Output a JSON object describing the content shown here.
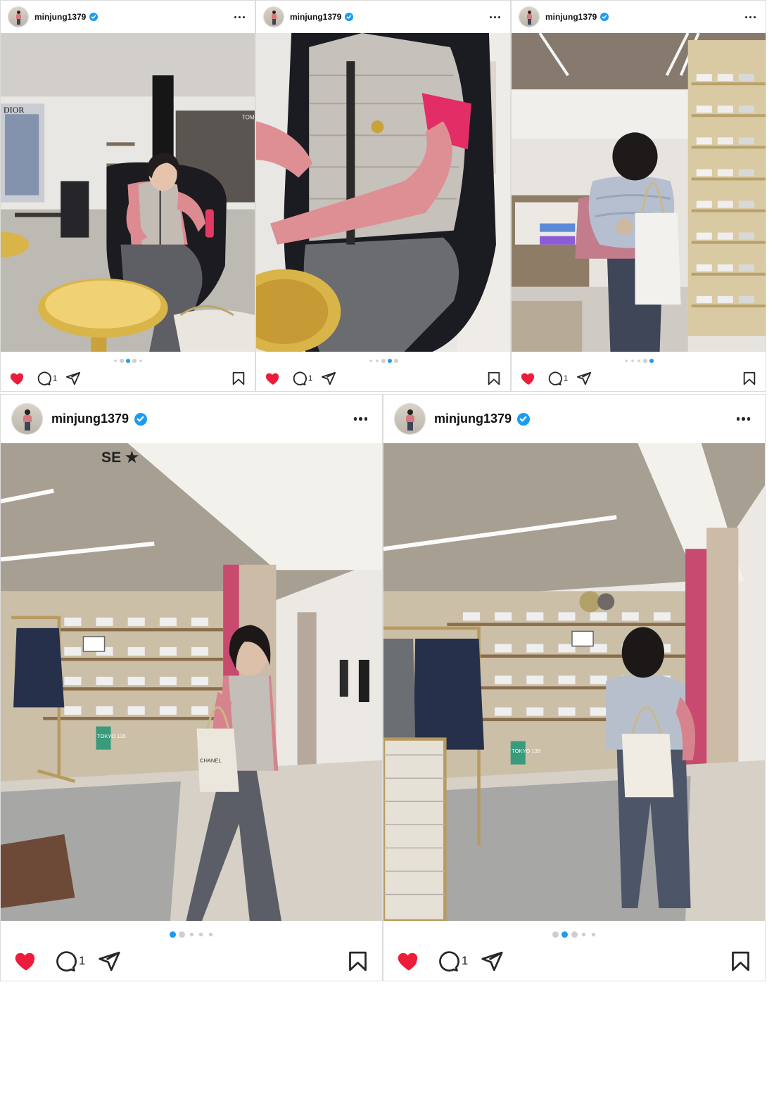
{
  "posts": [
    {
      "username": "minjung1379",
      "verified": true,
      "comment_count": "1",
      "liked": true,
      "carousel_total": 5,
      "carousel_active": 3,
      "photo_scene": "lounge-seated-gold-table"
    },
    {
      "username": "minjung1379",
      "verified": true,
      "comment_count": "1",
      "liked": true,
      "carousel_total": 5,
      "carousel_active": 4,
      "photo_scene": "closeup-vest-pink-sleeve"
    },
    {
      "username": "minjung1379",
      "verified": true,
      "comment_count": "1",
      "liked": true,
      "carousel_total": 5,
      "carousel_active": 5,
      "photo_scene": "back-view-sneaker-store"
    },
    {
      "username": "minjung1379",
      "verified": true,
      "comment_count": "1",
      "liked": true,
      "carousel_total": 5,
      "carousel_active": 1,
      "photo_scene": "walking-past-golden-goose-store"
    },
    {
      "username": "minjung1379",
      "verified": true,
      "comment_count": "1",
      "liked": true,
      "carousel_total": 5,
      "carousel_active": 2,
      "photo_scene": "standing-looking-at-shelves"
    }
  ],
  "icons": {
    "like": "heart-icon",
    "comment": "comment-icon",
    "share": "send-icon",
    "save": "bookmark-icon",
    "verified": "verified-badge-icon",
    "more": "more-options-icon"
  },
  "colors": {
    "heart": "#ed1c3a",
    "verified": "#1d9bf0",
    "active_dot": "#1d9bf0",
    "inactive_dot": "#cfcfcf"
  },
  "photo_text": {
    "store_sign_1": "DIOR",
    "store_sign_2": "TOM",
    "store_sign_3": "SE",
    "price_tag": "TOKYO 135",
    "bag_label": "CHANEL"
  }
}
